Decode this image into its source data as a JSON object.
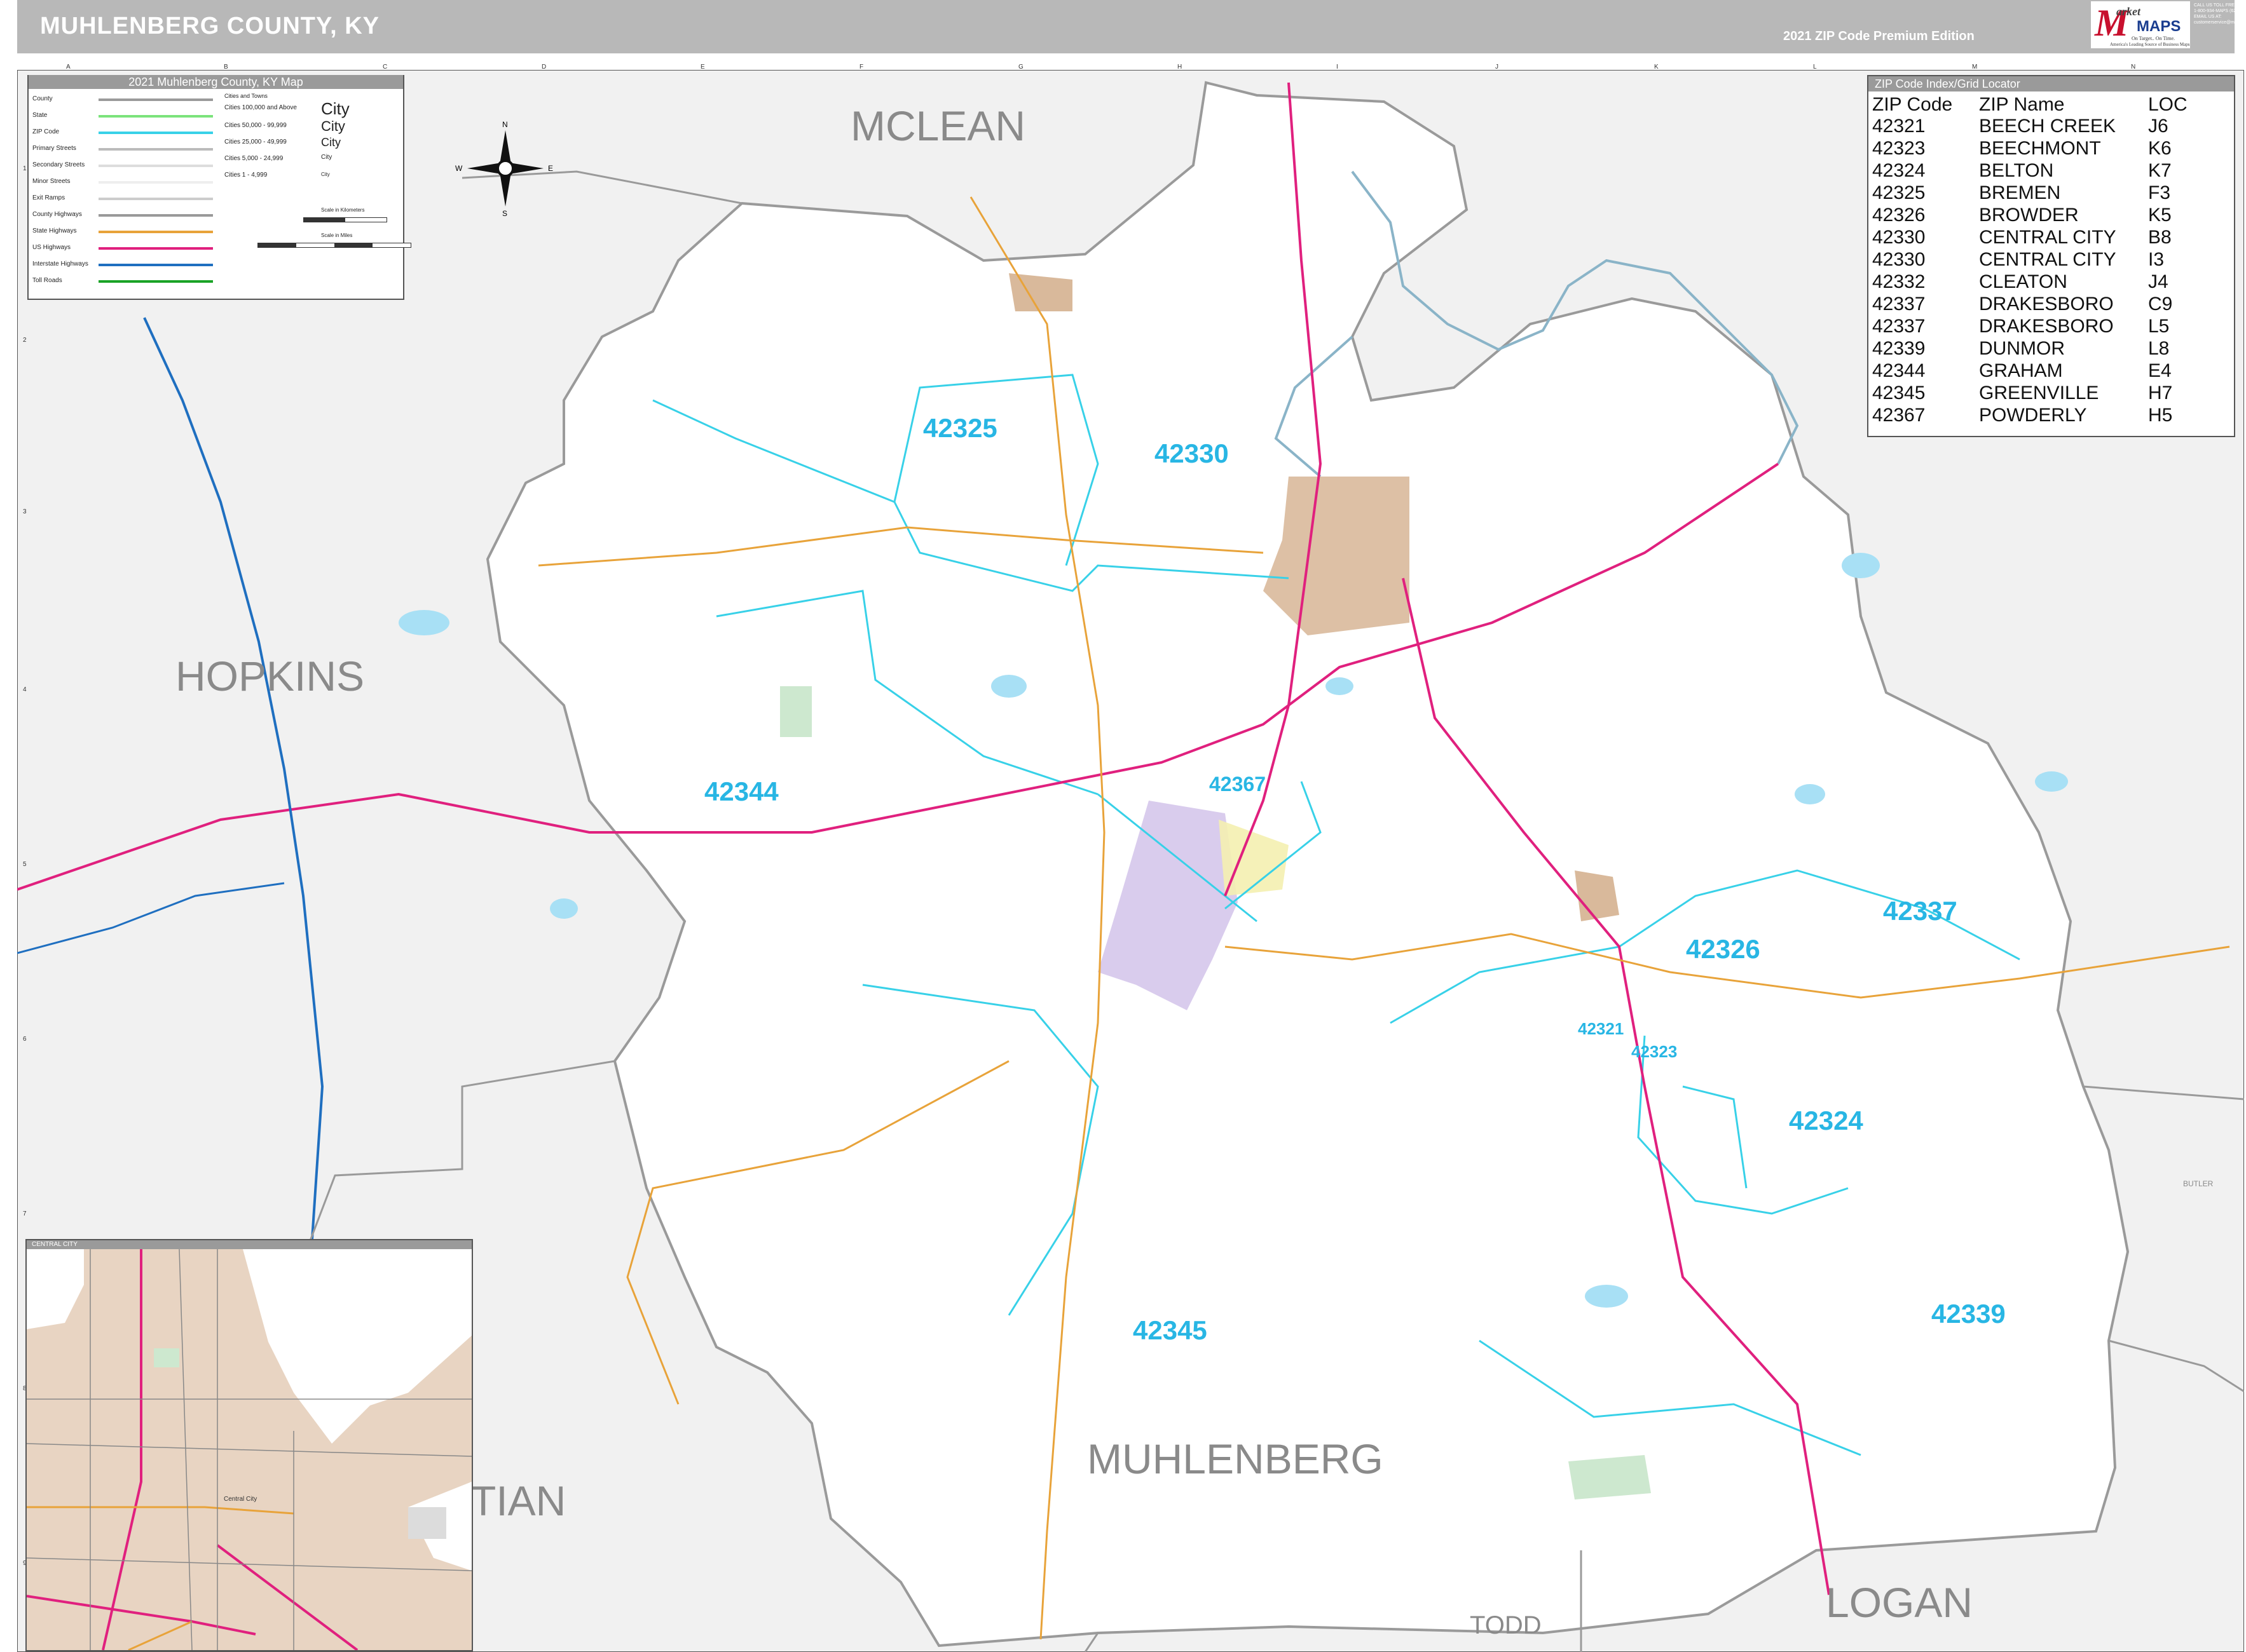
{
  "header": {
    "title": "MUHLENBERG COUNTY, KY",
    "edition": "2021 ZIP Code Premium Edition"
  },
  "logo": {
    "letter": "M",
    "word_market": "arket",
    "word_maps": "MAPS",
    "tagline_1": "On Target.. On Time.",
    "tagline_2": "America's Leading Source of Business Maps"
  },
  "contact": {
    "line_1": "CALL US TOLL FREE",
    "line_2": "1-800-934-MAPS (6277)",
    "line_3": "EMAIL US AT:",
    "line_4": "customerservice@marketmaps.com"
  },
  "legend": {
    "title": "2021 Muhlenberg County, KY Map",
    "road_rows": [
      {
        "label": "County",
        "color": "#9a9a9a"
      },
      {
        "label": "State",
        "color": "#7be37b"
      },
      {
        "label": "ZIP Code",
        "color": "#38d1e8"
      },
      {
        "label": "Primary Streets",
        "color": "#bbbbbb"
      },
      {
        "label": "Secondary Streets",
        "color": "#dddddd"
      },
      {
        "label": "Minor Streets",
        "color": "#eeeeee"
      },
      {
        "label": "Exit Ramps",
        "color": "#cccccc"
      },
      {
        "label": "County Highways",
        "color": "#999999"
      },
      {
        "label": "State Highways",
        "color": "#e8a33a"
      },
      {
        "label": "US Highways",
        "color": "#e0207e"
      },
      {
        "label": "Interstate Highways",
        "color": "#1f6fc0"
      },
      {
        "label": "Toll Roads",
        "color": "#1aa326"
      }
    ],
    "cities_title": "Cities and Towns",
    "city_rows": [
      {
        "label": "Cities 100,000 and Above",
        "sample": "City"
      },
      {
        "label": "Cities 50,000 - 99,999",
        "sample": "City"
      },
      {
        "label": "Cities 25,000 - 49,999",
        "sample": "City"
      },
      {
        "label": "Cities 5,000 - 24,999",
        "sample": "City"
      },
      {
        "label": "Cities 1 - 4,999",
        "sample": "City"
      }
    ],
    "scale_km": "Scale in Kilometers",
    "scale_mi": "Scale in Miles"
  },
  "compass": {
    "n": "N",
    "s": "S",
    "e": "E",
    "w": "W"
  },
  "zip_index": {
    "title": "ZIP Code Index/Grid Locator",
    "headers": [
      "ZIP Code",
      "ZIP Name",
      "LOC"
    ],
    "rows": [
      [
        "42321",
        "BEECH CREEK",
        "J6"
      ],
      [
        "42323",
        "BEECHMONT",
        "K6"
      ],
      [
        "42324",
        "BELTON",
        "K7"
      ],
      [
        "42325",
        "BREMEN",
        "F3"
      ],
      [
        "42326",
        "BROWDER",
        "K5"
      ],
      [
        "42330",
        "CENTRAL CITY",
        "B8"
      ],
      [
        "42330",
        "CENTRAL CITY",
        "I3"
      ],
      [
        "42332",
        "CLEATON",
        "J4"
      ],
      [
        "42337",
        "DRAKESBORO",
        "C9"
      ],
      [
        "42337",
        "DRAKESBORO",
        "L5"
      ],
      [
        "42339",
        "DUNMOR",
        "L8"
      ],
      [
        "42344",
        "GRAHAM",
        "E4"
      ],
      [
        "42345",
        "GREENVILLE",
        "H7"
      ],
      [
        "42367",
        "POWDERLY",
        "H5"
      ]
    ]
  },
  "county_labels": {
    "mclean": "MCLEAN",
    "hopkins": "HOPKINS",
    "muhlenberg": "MUHLENBERG",
    "christian": "TIAN",
    "todd": "TODD",
    "logan": "LOGAN",
    "butler": "BUTLER"
  },
  "zip_labels": {
    "z42325": "42325",
    "z42330": "42330",
    "z42344": "42344",
    "z42367": "42367",
    "z42326": "42326",
    "z42337": "42337",
    "z42321": "42321",
    "z42323": "42323",
    "z42324": "42324",
    "z42345": "42345",
    "z42339": "42339"
  },
  "inset": {
    "title": "CENTRAL CITY",
    "city_label": "Central City"
  },
  "grid": {
    "columns": [
      "A",
      "B",
      "C",
      "D",
      "E",
      "F",
      "G",
      "H",
      "I",
      "J",
      "K",
      "L",
      "M",
      "N"
    ],
    "rows": [
      "1",
      "2",
      "3",
      "4",
      "5",
      "6",
      "7",
      "8",
      "9"
    ]
  },
  "colors": {
    "county_fill": "#f1f1f1",
    "water": "#a8e0f5",
    "city_tan": "#d9b99b",
    "zip_line": "#38d1e8",
    "us_highway": "#e0207e",
    "state_highway": "#e8a33a",
    "interstate": "#1f6fc0"
  }
}
